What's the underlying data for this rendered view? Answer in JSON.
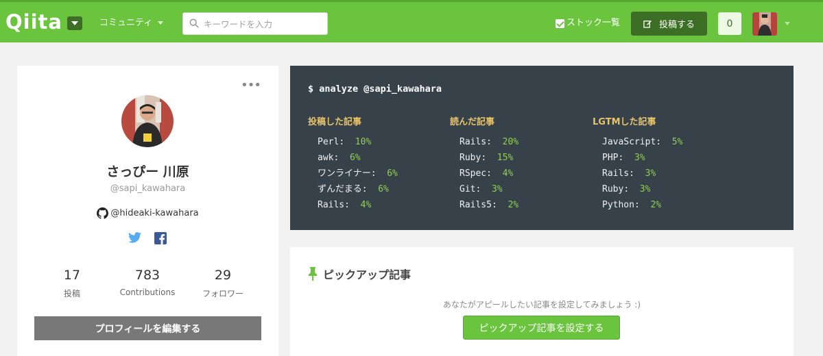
{
  "header": {
    "logo_text": "Qiita",
    "community_label": "コミュニティ",
    "search_placeholder": "キーワードを入力",
    "stock_label": "ストック一覧",
    "post_label": "投稿する",
    "notification_count": "0",
    "accent_color": "#6ac43e",
    "dark_accent": "#3c6e26"
  },
  "profile": {
    "name": "さっぴー 川原",
    "handle": "@sapi_kawahara",
    "github": "@hideaki-kawahara",
    "stats": [
      {
        "value": "17",
        "label": "投稿"
      },
      {
        "value": "783",
        "label": "Contributions"
      },
      {
        "value": "29",
        "label": "フォロワー"
      }
    ],
    "edit_button": "プロフィールを編集する",
    "icons": [
      "more-icon",
      "github-icon",
      "twitter-icon",
      "facebook-icon"
    ]
  },
  "analyze": {
    "command": "$ analyze @sapi_kawahara",
    "columns": [
      {
        "title": "投稿した記事",
        "items": [
          {
            "name": "Perl",
            "pct": "10%"
          },
          {
            "name": "awk",
            "pct": "6%"
          },
          {
            "name": "ワンライナー",
            "pct": "6%"
          },
          {
            "name": "ずんだまる",
            "pct": "6%"
          },
          {
            "name": "Rails",
            "pct": "4%"
          }
        ]
      },
      {
        "title": "読んだ記事",
        "items": [
          {
            "name": "Rails",
            "pct": "20%"
          },
          {
            "name": "Ruby",
            "pct": "15%"
          },
          {
            "name": "RSpec",
            "pct": "4%"
          },
          {
            "name": "Git",
            "pct": "3%"
          },
          {
            "name": "Rails5",
            "pct": "2%"
          }
        ]
      },
      {
        "title": "LGTMした記事",
        "items": [
          {
            "name": "JavaScript",
            "pct": "5%"
          },
          {
            "name": "PHP",
            "pct": "3%"
          },
          {
            "name": "Rails",
            "pct": "3%"
          },
          {
            "name": "Ruby",
            "pct": "3%"
          },
          {
            "name": "Python",
            "pct": "2%"
          }
        ]
      }
    ]
  },
  "pickup": {
    "title": "ピックアップ記事",
    "message": "あなたがアピールしたい記事を設定してみましょう :)",
    "button": "ピックアップ記事を設定する"
  }
}
